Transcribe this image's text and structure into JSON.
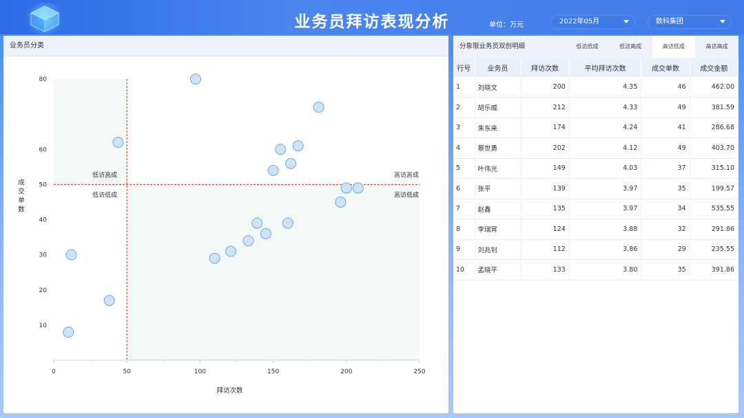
{
  "header": {
    "title": "业务员拜访表现分析",
    "unit_label": "单位：万元",
    "month_value": "2022年05月",
    "company_value": "数科集团"
  },
  "left_panel": {
    "title": "业务员分类"
  },
  "colors": {
    "point_fill": "#cfe3f7",
    "point_stroke": "#6ea8dc",
    "divider": "#cc2b2b",
    "quadrant_fill": "#f3f9f4"
  },
  "chart_data": {
    "type": "scatter",
    "xlabel": "拜访次数",
    "ylabel": "成交单数",
    "xlim": [
      0,
      250
    ],
    "ylim": [
      0,
      80
    ],
    "xticks": [
      "0",
      "50",
      "100",
      "150",
      "200",
      "250"
    ],
    "yticks": [
      "10",
      "20",
      "30",
      "40",
      "50",
      "60",
      "80"
    ],
    "ytick_values": [
      10,
      20,
      30,
      40,
      50,
      60,
      80
    ],
    "xtick_values": [
      0,
      50,
      100,
      150,
      200,
      250
    ],
    "divider_x": 50,
    "divider_y": 50,
    "quadrant_labels": {
      "top_left": "低访高成",
      "bottom_left": "低访低成",
      "top_right": "高访高成",
      "bottom_right": "高访低成"
    },
    "points": [
      {
        "x": 97,
        "y": 80
      },
      {
        "x": 44,
        "y": 62
      },
      {
        "x": 155,
        "y": 60
      },
      {
        "x": 181,
        "y": 72
      },
      {
        "x": 167,
        "y": 61
      },
      {
        "x": 150,
        "y": 54
      },
      {
        "x": 162,
        "y": 56
      },
      {
        "x": 200,
        "y": 49
      },
      {
        "x": 208,
        "y": 49
      },
      {
        "x": 196,
        "y": 45
      },
      {
        "x": 139,
        "y": 39
      },
      {
        "x": 145,
        "y": 36
      },
      {
        "x": 160,
        "y": 39
      },
      {
        "x": 133,
        "y": 34
      },
      {
        "x": 121,
        "y": 31
      },
      {
        "x": 110,
        "y": 29
      },
      {
        "x": 12,
        "y": 30
      },
      {
        "x": 38,
        "y": 17
      },
      {
        "x": 10,
        "y": 8
      }
    ]
  },
  "right_panel": {
    "title": "分象限业务员双创明细",
    "tabs": [
      "低访低成",
      "低访高成",
      "高访低成",
      "高访高成"
    ],
    "active_tab": 2,
    "columns": [
      "行号",
      "业务员",
      "拜访次数",
      "平均拜访次数",
      "成交单数",
      "成交金额"
    ],
    "rows": [
      [
        "1",
        "刘晓文",
        "200",
        "4.35",
        "46",
        "462.00"
      ],
      [
        "2",
        "胡乐威",
        "212",
        "4.33",
        "49",
        "381.59"
      ],
      [
        "3",
        "朱东来",
        "174",
        "4.24",
        "41",
        "286.68"
      ],
      [
        "4",
        "蔡世勇",
        "202",
        "4.12",
        "49",
        "403.70"
      ],
      [
        "5",
        "叶伟光",
        "149",
        "4.03",
        "37",
        "315.10"
      ],
      [
        "6",
        "张平",
        "139",
        "3.97",
        "35",
        "199.57"
      ],
      [
        "7",
        "赵鑫",
        "135",
        "3.97",
        "34",
        "535.55"
      ],
      [
        "8",
        "李瑞宵",
        "124",
        "3.88",
        "32",
        "291.86"
      ],
      [
        "9",
        "刘兆钊",
        "112",
        "3.86",
        "29",
        "235.55"
      ],
      [
        "10",
        "孟晓平",
        "133",
        "3.80",
        "35",
        "391.86"
      ]
    ]
  }
}
